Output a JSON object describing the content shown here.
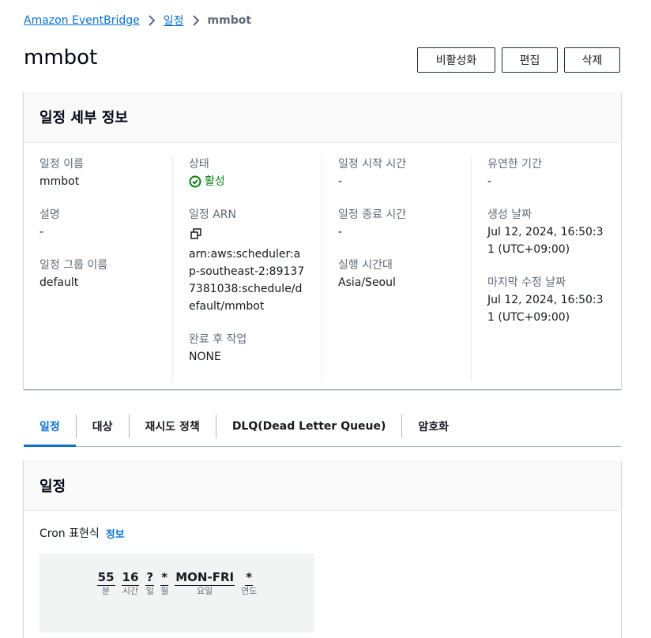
{
  "breadcrumb": {
    "root": "Amazon EventBridge",
    "section": "일정",
    "current": "mmbot"
  },
  "page_title": "mmbot",
  "actions": {
    "deactivate": "비활성화",
    "edit": "편집",
    "delete": "삭제"
  },
  "details": {
    "title": "일정 세부 정보",
    "schedule_name_label": "일정 이름",
    "schedule_name": "mmbot",
    "description_label": "설명",
    "description": "-",
    "group_label": "일정 그룹 이름",
    "group": "default",
    "status_label": "상태",
    "status": "활성",
    "arn_label": "일정 ARN",
    "arn": "arn:aws:scheduler:ap-southeast-2:891377381038:schedule/default/mmbot",
    "after_completion_label": "완료 후 작업",
    "after_completion": "NONE",
    "start_time_label": "일정 시작 시간",
    "start_time": "-",
    "end_time_label": "일정 종료 시간",
    "end_time": "-",
    "timezone_label": "실행 시간대",
    "timezone": "Asia/Seoul",
    "flex_window_label": "유연한 기간",
    "flex_window": "-",
    "created_label": "생성 날짜",
    "created": "Jul 12, 2024, 16:50:31 (UTC+09:00)",
    "modified_label": "마지막 수정 날짜",
    "modified": "Jul 12, 2024, 16:50:31 (UTC+09:00)"
  },
  "tabs": [
    "일정",
    "대상",
    "재시도 정책",
    "DLQ(Dead Letter Queue)",
    "암호화"
  ],
  "schedule": {
    "title": "일정",
    "cron_label": "Cron 표현식",
    "info": "정보",
    "cron_parts": [
      {
        "value": "55",
        "unit": "분"
      },
      {
        "value": "16",
        "unit": "시간"
      },
      {
        "value": "?",
        "unit": "일"
      },
      {
        "value": "*",
        "unit": "월"
      },
      {
        "value": "MON-FRI",
        "unit": "요일"
      },
      {
        "value": "*",
        "unit": "연도"
      }
    ]
  },
  "colors": {
    "link": "#0972d3",
    "success": "#037f0c"
  }
}
